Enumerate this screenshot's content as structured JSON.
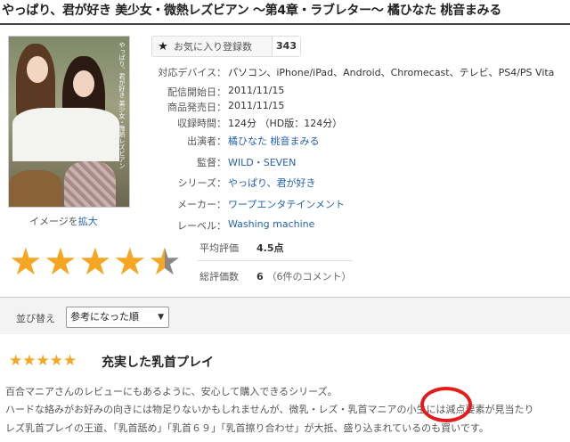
{
  "product": {
    "title": "やっぱり、君が好き 美少女・微熱レズビアン 〜第4章・ラブレター〜 橘ひなた 桃音まみる"
  },
  "cover": {
    "vertical_text": "やっぱり、君が好き 美少女・微熱レズビアン",
    "link_prefix": "イメージを",
    "link_label": "拡大"
  },
  "favorite": {
    "icon": "star-icon",
    "label": "お気に入り登録数",
    "count": "343"
  },
  "specs": [
    {
      "label": "対応デバイス：",
      "value": "パソコン、iPhone/iPad、Android、Chromecast、テレビ、PS4/PS Vita",
      "link": false
    },
    {
      "label": "配信開始日：",
      "value": "2011/11/15",
      "link": false
    },
    {
      "label": "商品発売日：",
      "value": "2011/11/15",
      "link": false
    },
    {
      "label": "収録時間：",
      "value": "124分 （HD版：124分）",
      "link": false
    },
    {
      "label": "出演者：",
      "value": "橘ひなた 桃音まみる",
      "link": true
    },
    {
      "label": "監督：",
      "value": "WILD・SEVEN",
      "link": true
    },
    {
      "label": "シリーズ：",
      "value": "やっぱり、君が好き",
      "link": true
    },
    {
      "label": "メーカー：",
      "value": "ワープエンタテインメント",
      "link": true
    },
    {
      "label": "レーベル：",
      "value": "Washing machine",
      "link": true
    }
  ],
  "rating": {
    "stars": 4.5,
    "avg_label": "平均評価",
    "avg_value": "4.5点",
    "count_label": "総評価数",
    "count_value": "6",
    "count_note": "（6件のコメント）"
  },
  "sort": {
    "label": "並び替え",
    "selected": "参考になった順"
  },
  "review": {
    "stars": 5,
    "title": "充実した乳首プレイ",
    "lines": [
      "百合マニアさんのレビューにもあるように、安心して購入できるシリーズ。",
      "ハードな絡みがお好みの向きには物足りないかもしれませんが、微乳・レズ・乳首マニアの小生には減点要素が見当たり",
      "レズ乳首プレイの王道、「乳首舐め」「乳首６９」「乳首擦り合わせ」が大抵、盛り込まれているのも買いです。"
    ]
  },
  "colors": {
    "star": "#f5a623",
    "link": "#2563b0",
    "annotation_circle": "#e41b1b"
  }
}
